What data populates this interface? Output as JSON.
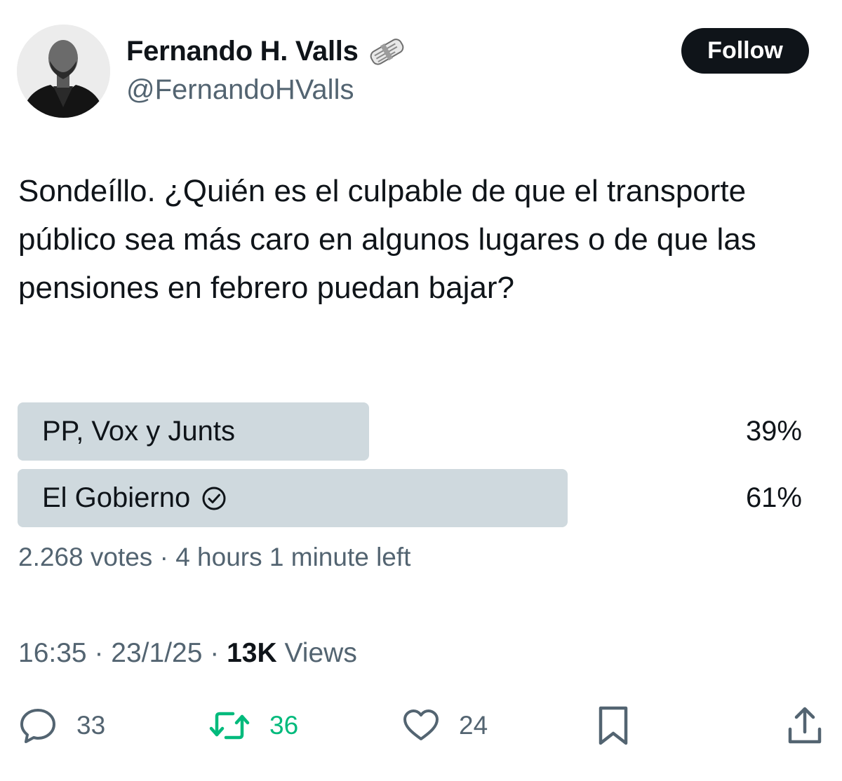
{
  "author": {
    "display_name": "Fernando H. Valls",
    "name_emoji": "newspaper-roll-icon",
    "handle": "@FernandoHValls",
    "follow_label": "Follow"
  },
  "tweet": {
    "text": "Sondeíllo. ¿Quién es el culpable de que el transporte público sea más caro en algunos lugares o de que las pensiones en febrero puedan bajar?"
  },
  "poll": {
    "options": [
      {
        "label": "PP, Vox y Junts",
        "percent_label": "39%",
        "value": 0.39,
        "selected": false
      },
      {
        "label": "El Gobierno",
        "percent_label": "61%",
        "value": 0.61,
        "selected": true
      }
    ],
    "votes": "2.268 votes",
    "separator": "·",
    "time_left": "4 hours 1 minute left"
  },
  "meta": {
    "time": "16:35",
    "date": "23/1/25",
    "separator": "·",
    "views_count": "13K",
    "views_label": "Views"
  },
  "actions": {
    "reply_count": "33",
    "retweet_count": "36",
    "like_count": "24"
  },
  "colors": {
    "text": "#0f1419",
    "secondary": "#536471",
    "poll_bar": "#cfd9de",
    "retweet_green": "#00ba7c",
    "button_bg": "#0f1419"
  }
}
